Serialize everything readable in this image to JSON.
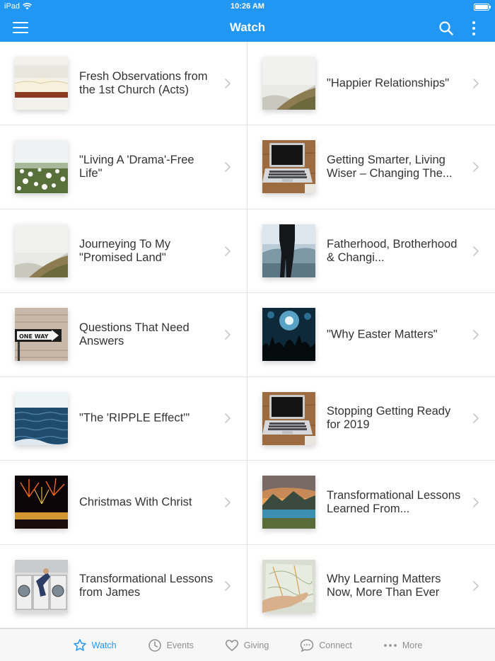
{
  "status_bar": {
    "device": "iPad",
    "time": "10:26 AM"
  },
  "nav": {
    "title": "Watch"
  },
  "items": [
    {
      "title": "Fresh Observations from the 1st Church (Acts)",
      "thumb": "book-image"
    },
    {
      "title": "\"Happier Relationships\"",
      "thumb": "hills-mist-image"
    },
    {
      "title": "\"Living A 'Drama'-Free Life\"",
      "thumb": "dandelion-field-image"
    },
    {
      "title": "Getting Smarter, Living Wiser – Changing The...",
      "thumb": "laptop-desk-image"
    },
    {
      "title": "Journeying To My \"Promised Land\"",
      "thumb": "hills-mist-image"
    },
    {
      "title": "Fatherhood, Brotherhood & Changi...",
      "thumb": "man-silhouette-image"
    },
    {
      "title": "Questions That Need Answers",
      "thumb": "one-way-sign-image",
      "sign_text": "ONE WAY"
    },
    {
      "title": "\"Why Easter Matters\"",
      "thumb": "concert-crowd-image"
    },
    {
      "title": "\"The 'RIPPLE Effect'\"",
      "thumb": "sea-waves-image"
    },
    {
      "title": "Stopping Getting Ready for 2019",
      "thumb": "laptop-desk-image"
    },
    {
      "title": "Christmas With Christ",
      "thumb": "fireworks-image"
    },
    {
      "title": "Transformational Lessons Learned From...",
      "thumb": "mountain-lake-image"
    },
    {
      "title": "Transformational Lessons from James",
      "thumb": "laundromat-image"
    },
    {
      "title": "Why Learning Matters Now, More Than Ever",
      "thumb": "map-hand-image"
    }
  ],
  "tabs": [
    {
      "label": "Watch",
      "icon": "star-icon",
      "active": true
    },
    {
      "label": "Events",
      "icon": "clock-icon",
      "active": false
    },
    {
      "label": "Giving",
      "icon": "heart-icon",
      "active": false
    },
    {
      "label": "Connect",
      "icon": "chat-bubble-icon",
      "active": false
    },
    {
      "label": "More",
      "icon": "ellipsis-icon",
      "active": false
    }
  ],
  "colors": {
    "brand": "#2196f3",
    "tab_inactive": "#8e8e8e",
    "text": "#333333"
  }
}
